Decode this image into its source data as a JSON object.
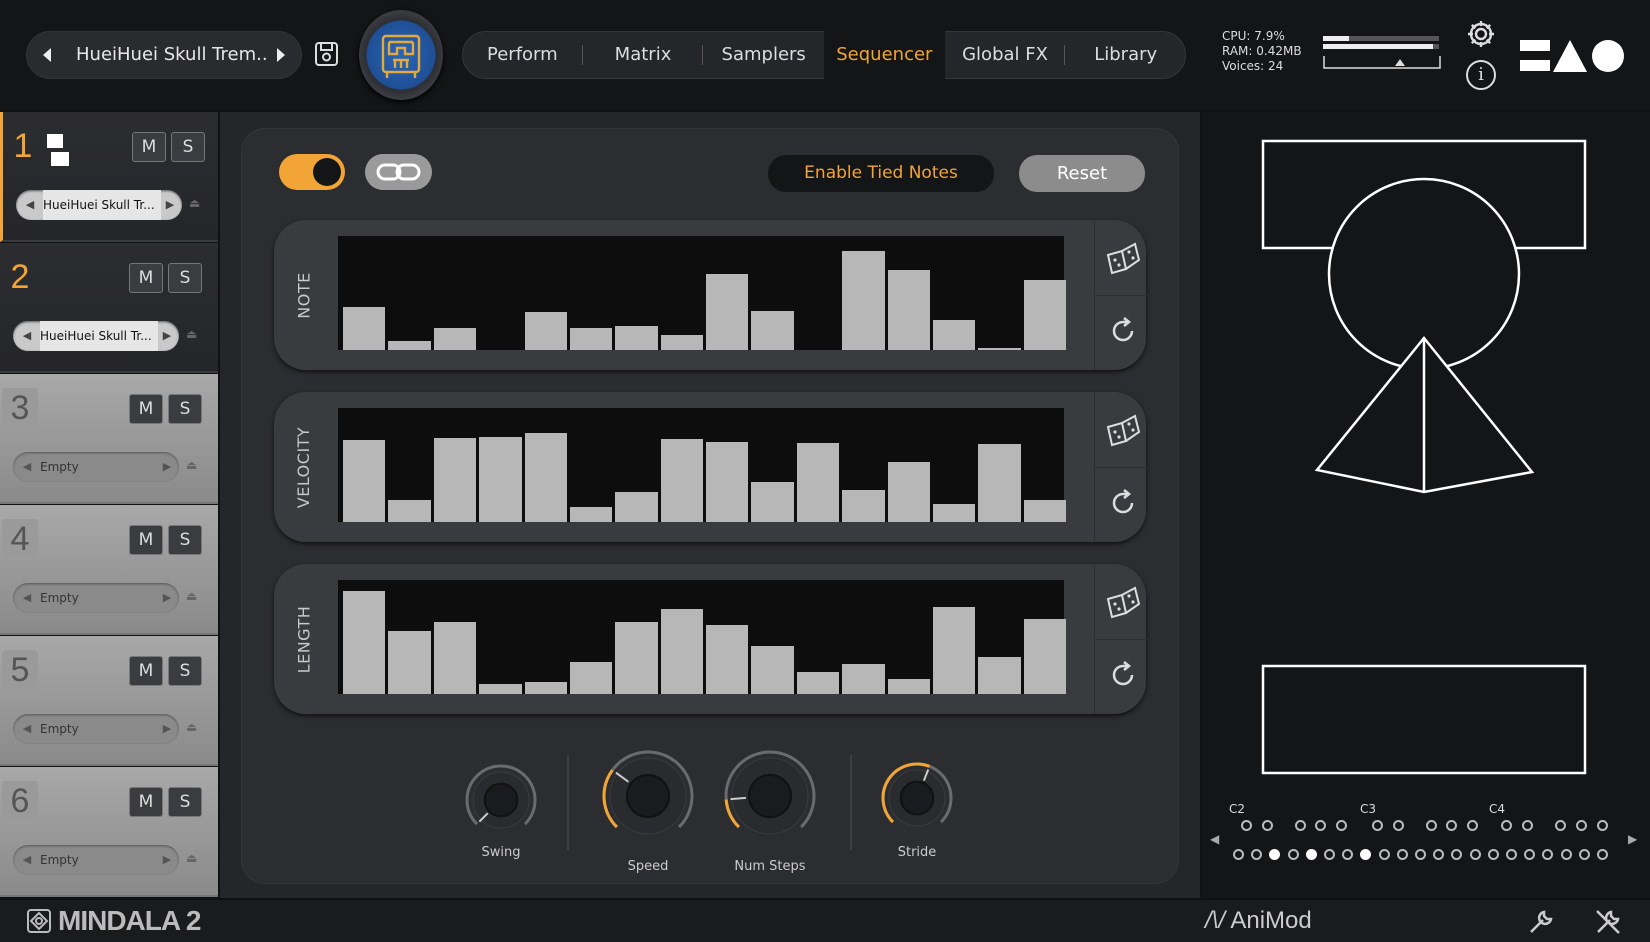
{
  "header": {
    "preset_name": "HueiHuei Skull Trem..",
    "tabs": [
      {
        "label": "Perform",
        "active": false
      },
      {
        "label": "Matrix",
        "active": false
      },
      {
        "label": "Samplers",
        "active": false
      },
      {
        "label": "Sequencer",
        "active": true
      },
      {
        "label": "Global FX",
        "active": false
      },
      {
        "label": "Library",
        "active": false
      }
    ],
    "stats": {
      "cpu": "CPU: 7.9%",
      "ram": "RAM: 0.42MB",
      "voices": "Voices: 24"
    },
    "meter_fill": [
      0.22,
      0.95,
      0.7
    ]
  },
  "sidebar": {
    "slots": [
      {
        "num": "1",
        "m": "M",
        "s": "S",
        "sample": "HueiHuei Skull Tr...",
        "loaded": true,
        "selected": true
      },
      {
        "num": "2",
        "m": "M",
        "s": "S",
        "sample": "HueiHuei Skull Tr...",
        "loaded": true,
        "selected": false
      },
      {
        "num": "3",
        "m": "M",
        "s": "S",
        "sample": "Empty",
        "loaded": false,
        "selected": false
      },
      {
        "num": "4",
        "m": "M",
        "s": "S",
        "sample": "Empty",
        "loaded": false,
        "selected": false
      },
      {
        "num": "5",
        "m": "M",
        "s": "S",
        "sample": "Empty",
        "loaded": false,
        "selected": false
      },
      {
        "num": "6",
        "m": "M",
        "s": "S",
        "sample": "Empty",
        "loaded": false,
        "selected": false
      }
    ]
  },
  "sequencer": {
    "enabled": true,
    "tied_notes_label": "Enable Tied Notes",
    "reset_label": "Reset",
    "lanes": [
      {
        "label": "NOTE",
        "values": [
          0.4,
          0.08,
          0.2,
          0.0,
          0.35,
          0.2,
          0.22,
          0.14,
          0.7,
          0.36,
          0.0,
          0.92,
          0.74,
          0.28,
          0.02,
          0.65
        ]
      },
      {
        "label": "VELOCITY",
        "values": [
          0.76,
          0.2,
          0.78,
          0.79,
          0.82,
          0.14,
          0.28,
          0.77,
          0.74,
          0.37,
          0.73,
          0.3,
          0.56,
          0.17,
          0.72,
          0.2
        ]
      },
      {
        "label": "LENGTH",
        "values": [
          0.95,
          0.58,
          0.67,
          0.09,
          0.11,
          0.3,
          0.67,
          0.79,
          0.64,
          0.44,
          0.2,
          0.28,
          0.14,
          0.81,
          0.34,
          0.69
        ]
      }
    ],
    "knobs": [
      {
        "label": "Swing",
        "value": 0.0
      },
      {
        "label": "Speed",
        "value": 0.3
      },
      {
        "label": "Num Steps",
        "value": 0.15
      },
      {
        "label": "Stride",
        "value": 0.58
      }
    ]
  },
  "keyboard": {
    "octave_labels": [
      "C2",
      "C3",
      "C4"
    ],
    "top_row_active": [],
    "bottom_row_active": [
      2,
      4,
      7
    ]
  },
  "footer": {
    "brand": "MINDALA 2",
    "animod": "AniMod"
  },
  "colors": {
    "accent": "#f2a536",
    "bar": "#b7b7b8"
  }
}
